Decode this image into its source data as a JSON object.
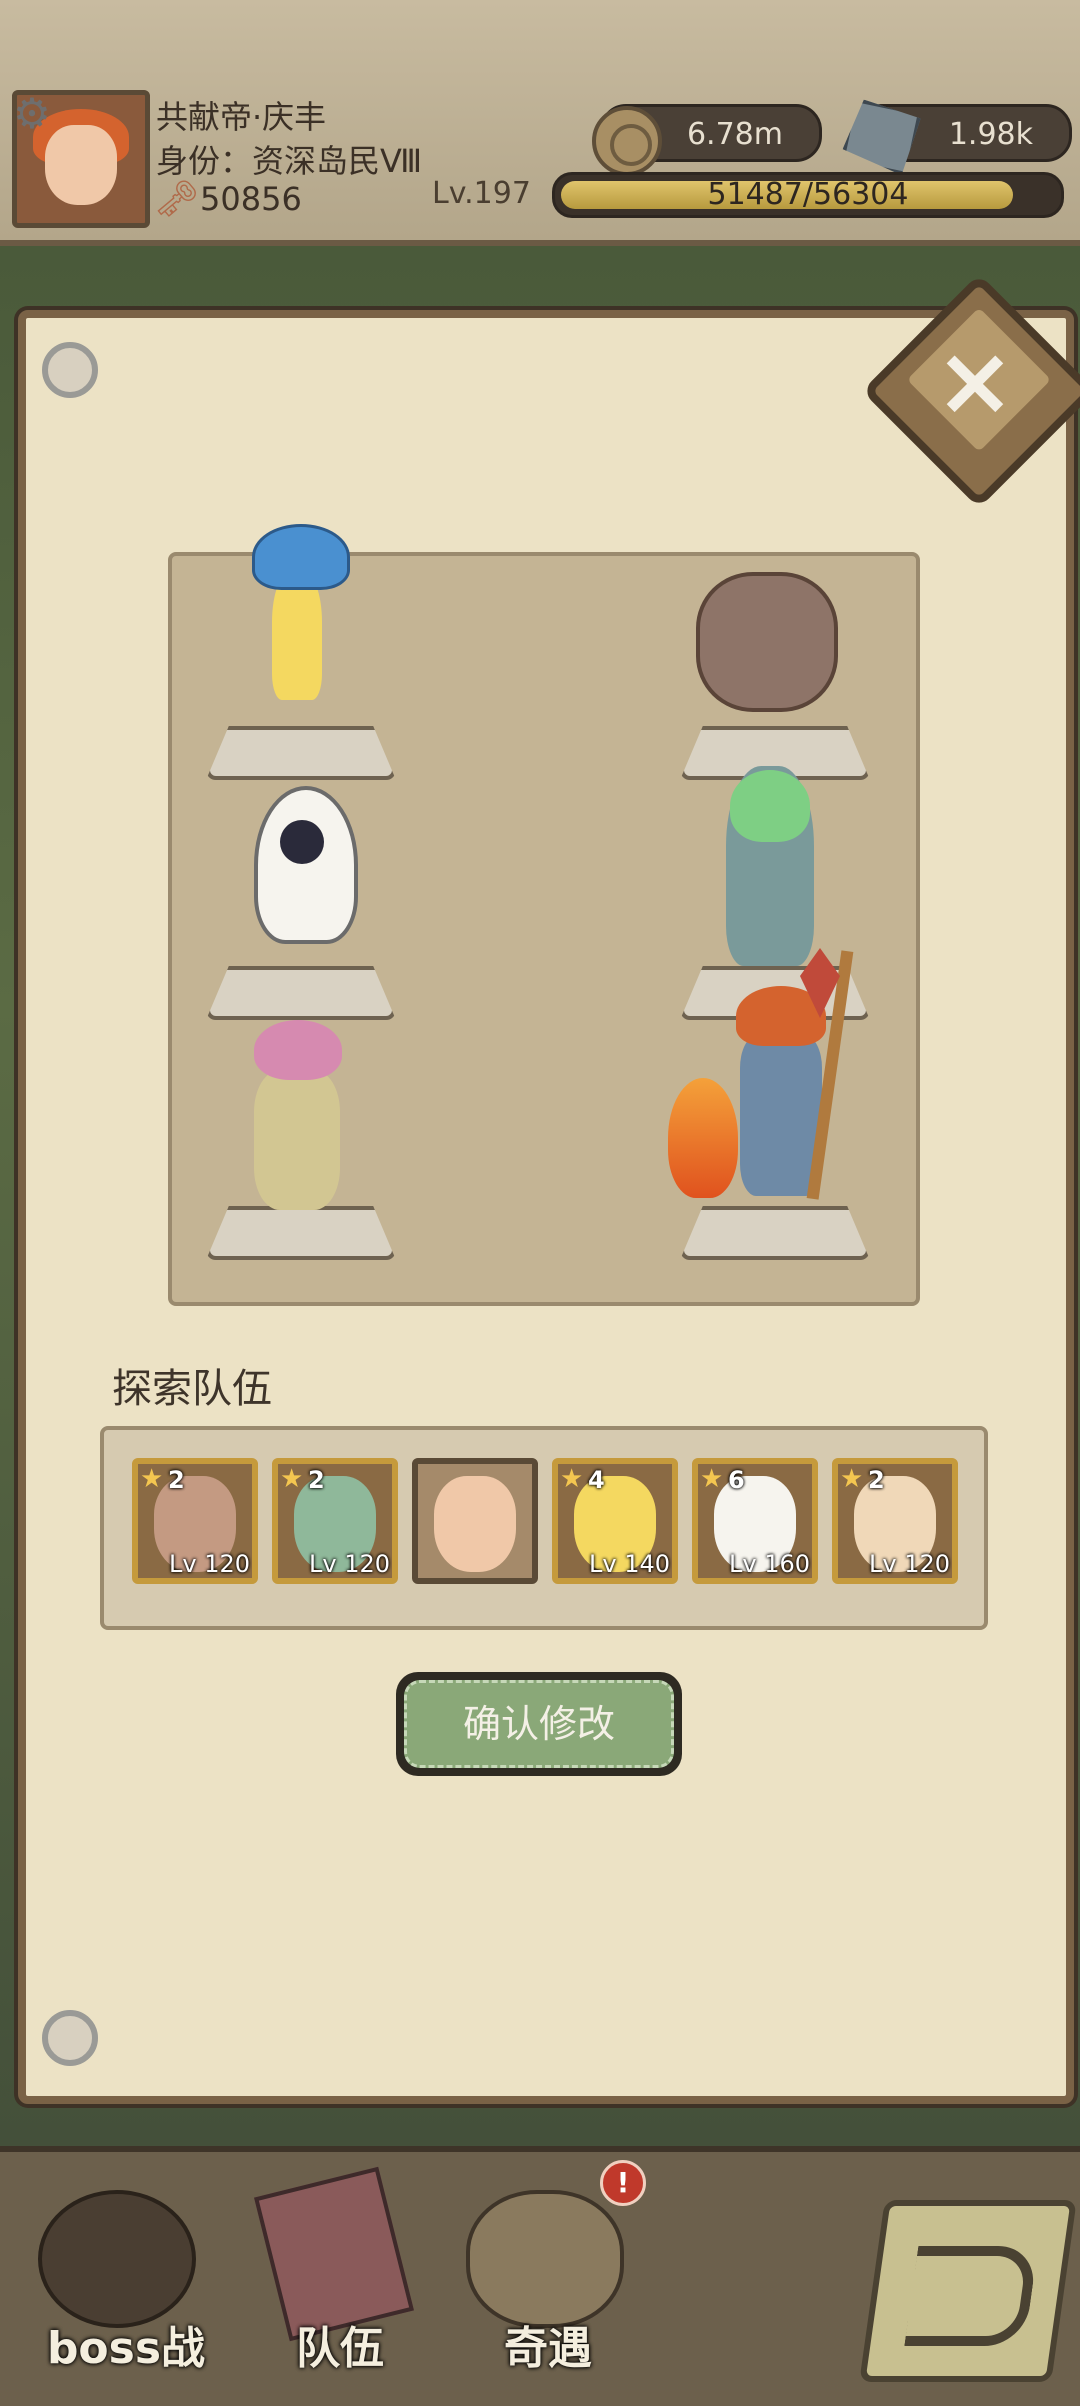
{
  "header": {
    "player_name": "共献帝·庆丰",
    "identity": "身份：资深岛民Ⅷ",
    "power": "50856",
    "level": "Lv.197",
    "coins": "6.78m",
    "stones": "1.98k",
    "xp_text": "51487/56304",
    "xp_fraction": 0.914
  },
  "panel": {
    "close_label": "×",
    "team_title": "探索队伍",
    "confirm_label": "确认修改"
  },
  "team": [
    {
      "stars": "2",
      "level": "Lv 120",
      "color": "#c49a82",
      "name": "golem"
    },
    {
      "stars": "2",
      "level": "Lv 120",
      "color": "#8fb89a",
      "name": "green-girl"
    },
    {
      "stars": "",
      "level": "",
      "color": "#f0c8a8",
      "name": "leader",
      "plain": true
    },
    {
      "stars": "4",
      "level": "Lv 140",
      "color": "#f4d860",
      "name": "mushroom-girl"
    },
    {
      "stars": "6",
      "level": "Lv 160",
      "color": "#f6f4ee",
      "name": "ghost"
    },
    {
      "stars": "2",
      "level": "Lv 120",
      "color": "#f0d8b8",
      "name": "flower-girl"
    }
  ],
  "nav": {
    "boss": "boss战",
    "team": "队伍",
    "encounter": "奇遇",
    "badge": "!"
  }
}
